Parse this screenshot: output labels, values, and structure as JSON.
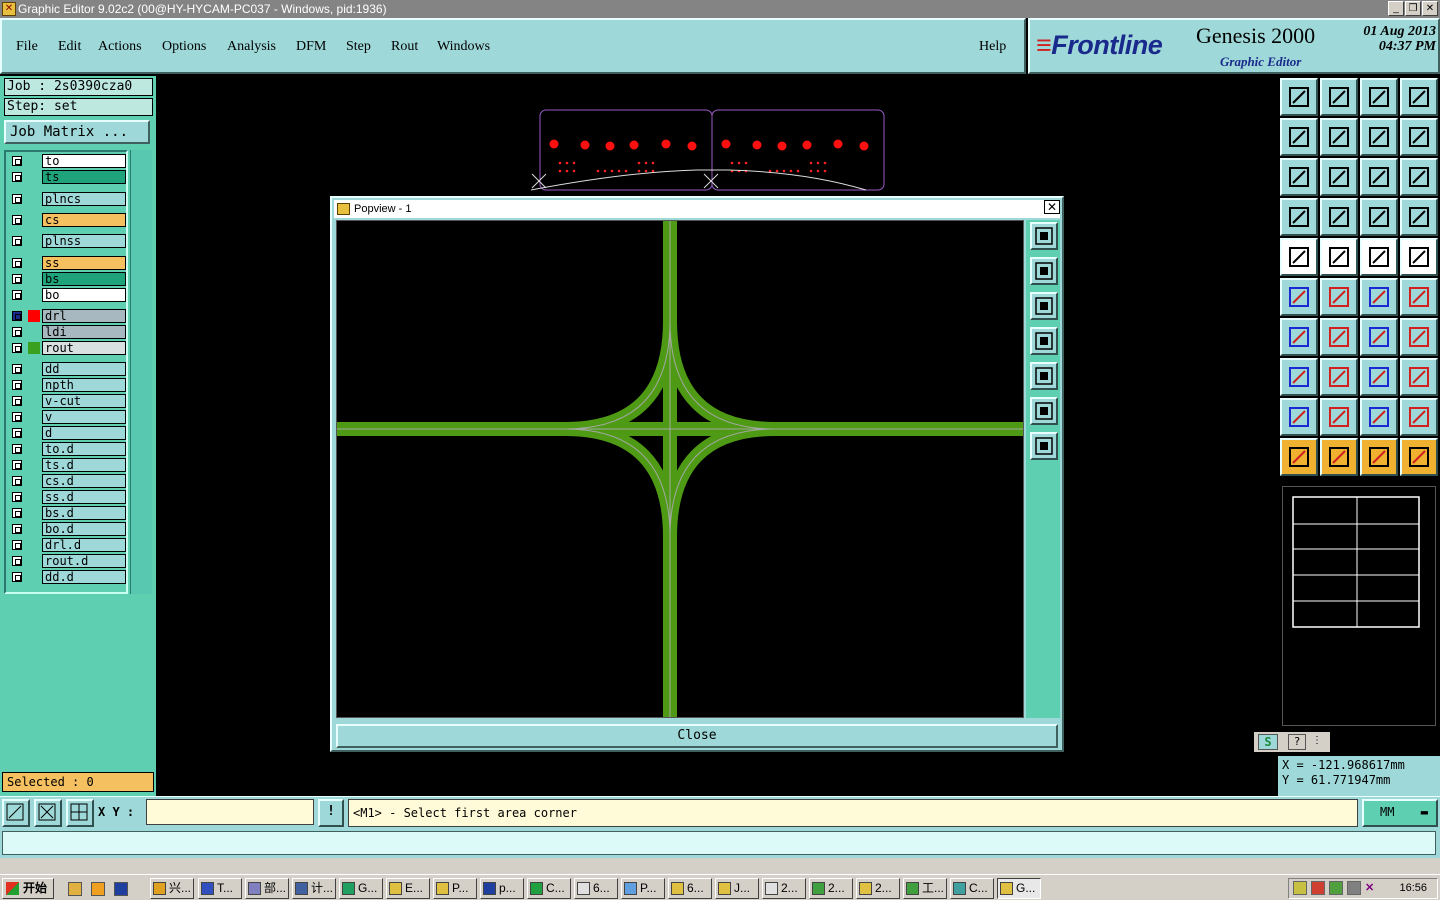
{
  "window": {
    "title": "Graphic Editor 9.02c2 (00@HY-HYCAM-PC037 - Windows, pid:1936)"
  },
  "menu": {
    "items": [
      "File",
      "Edit",
      "Actions",
      "Options",
      "Analysis",
      "DFM",
      "Step",
      "Rout",
      "Windows"
    ],
    "help": "Help"
  },
  "brand": {
    "logo": "Frontline",
    "product": "Genesis 2000",
    "subtitle": "Graphic Editor",
    "date": "01 Aug 2013",
    "time": "04:37 PM"
  },
  "job": {
    "job_line": "Job : 2s0390cza0",
    "step_line": "Step: set",
    "matrix_button": "Job Matrix ..."
  },
  "layers": [
    {
      "name": "to",
      "color": "#ffffff"
    },
    {
      "name": "ts",
      "color": "#1fa37a"
    },
    {
      "name": "plncs",
      "color": "#9ed8d8"
    },
    {
      "name": "cs",
      "color": "#f4c060"
    },
    {
      "name": "plnss",
      "color": "#9ed8d8"
    },
    {
      "name": "ss",
      "color": "#f4c060"
    },
    {
      "name": "bs",
      "color": "#1fa37a"
    },
    {
      "name": "bo",
      "color": "#ffffff"
    },
    {
      "name": "drl",
      "color": "#a8b8c0"
    },
    {
      "name": "ldi",
      "color": "#a8b8c0"
    },
    {
      "name": "rout",
      "color": "#d8e0e0"
    },
    {
      "name": "dd",
      "color": "#9ed8d8"
    },
    {
      "name": "npth",
      "color": "#9ed8d8"
    },
    {
      "name": "v-cut",
      "color": "#9ed8d8"
    },
    {
      "name": "v",
      "color": "#9ed8d8"
    },
    {
      "name": "d",
      "color": "#9ed8d8"
    },
    {
      "name": "to.d",
      "color": "#9ed8d8"
    },
    {
      "name": "ts.d",
      "color": "#9ed8d8"
    },
    {
      "name": "cs.d",
      "color": "#9ed8d8"
    },
    {
      "name": "ss.d",
      "color": "#9ed8d8"
    },
    {
      "name": "bs.d",
      "color": "#9ed8d8"
    },
    {
      "name": "bo.d",
      "color": "#9ed8d8"
    },
    {
      "name": "drl.d",
      "color": "#9ed8d8"
    },
    {
      "name": "rout.d",
      "color": "#9ed8d8"
    },
    {
      "name": "dd.d",
      "color": "#9ed8d8"
    }
  ],
  "selected": "Selected : 0",
  "popview": {
    "title": "Popview - 1",
    "close_label": "Close"
  },
  "coords": {
    "x": "X  =  -121.968617mm",
    "y": "Y  =  61.771947mm"
  },
  "status": {
    "xy_label": "X Y :",
    "xy_value": "",
    "help_button": "!",
    "prompt": "<M1> - Select first area corner",
    "units": "MM"
  },
  "taskbar": {
    "start": "开始",
    "tasks": [
      "兴...",
      "T...",
      "部...",
      "计...",
      "G...",
      "E...",
      "P...",
      "p...",
      "C...",
      "6...",
      "P...",
      "6...",
      "J...",
      "2...",
      "2...",
      "2...",
      "工...",
      "C...",
      "G..."
    ],
    "clock": "16:56"
  },
  "colors": {
    "panel": "#9ed8d8",
    "panel_dark": "#5ecfb1",
    "route": "#4f9a14",
    "drill": "#ff0000",
    "profile": "#9a5cc8"
  }
}
